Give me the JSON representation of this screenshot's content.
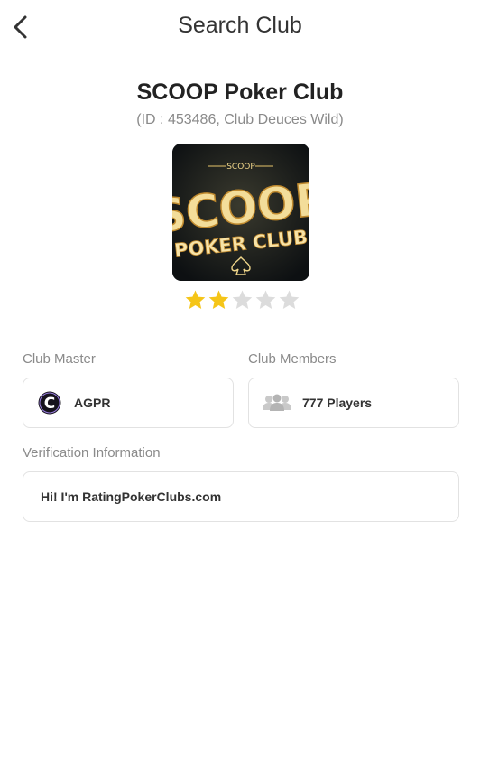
{
  "header": {
    "title": "Search Club",
    "back_icon": "chevron-left-icon"
  },
  "club": {
    "name": "SCOOP Poker Club",
    "subtitle": "(ID : 453486, Club Deuces Wild)",
    "logo": {
      "small_text": "SCOOP",
      "big_text": "SCOOP",
      "line2": "POKER CLUB"
    },
    "rating": 2,
    "rating_max": 5
  },
  "master": {
    "label": "Club Master",
    "name": "AGPR",
    "avatar_letter": "C"
  },
  "members": {
    "label": "Club Members",
    "value": "777 Players",
    "icon": "people-icon"
  },
  "verification": {
    "label": "Verification Information",
    "text": "Hi! I'm RatingPokerClubs.com"
  },
  "colors": {
    "star_filled": "#f5c518",
    "star_empty": "#dcdcdc",
    "border": "#e2e2e2",
    "label": "#8a8a8a"
  }
}
